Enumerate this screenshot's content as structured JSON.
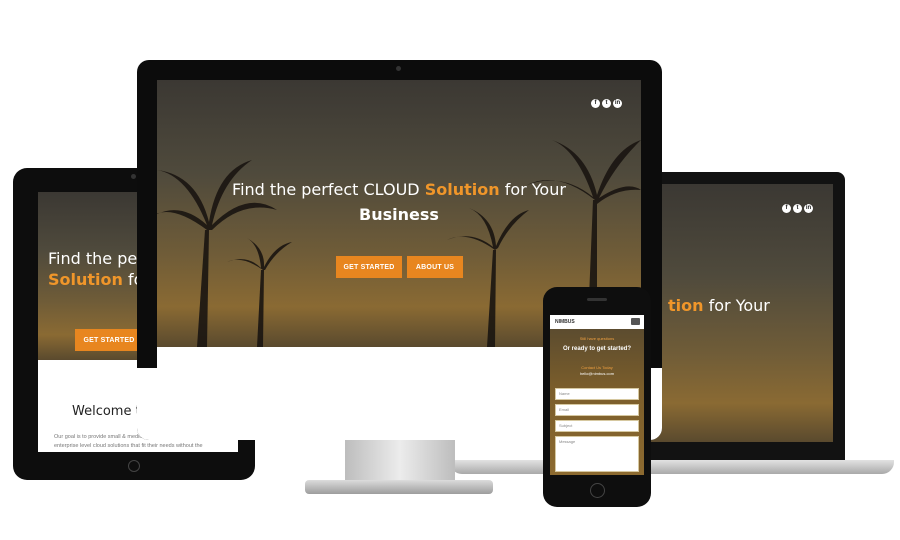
{
  "desktop": {
    "headline_pre": "Find the perfect CLOUD ",
    "headline_accent": "Solution",
    "headline_post": " for Your",
    "headline_line2": "Business",
    "btn_primary": "GET STARTED",
    "btn_secondary": "ABOUT US",
    "social": [
      "f",
      "t",
      "in"
    ]
  },
  "tablet": {
    "headline_line1": "Find the pe",
    "headline_accent": "Solution",
    "headline_post": " for Y",
    "btn_primary": "GET STARTED",
    "welcome": "Welcome t",
    "body_line1": "Our goal is to provide small & medium size businesses with",
    "body_line2": "enterprise level cloud solutions that fit their needs without the"
  },
  "laptop": {
    "headline_accent": "tion",
    "headline_post": " for Your",
    "social": [
      "f",
      "t",
      "in"
    ]
  },
  "phone": {
    "logo": "NIMBUS",
    "tagline": "Still have questions",
    "ready": "Or ready to get started?",
    "contact_label": "Contact Us Today",
    "contact_email": "hello@nimbus.com",
    "fields": [
      "Name",
      "Email",
      "Subject",
      "Message"
    ]
  },
  "colors": {
    "accent": "#e8861f",
    "bezel": "#111111"
  }
}
